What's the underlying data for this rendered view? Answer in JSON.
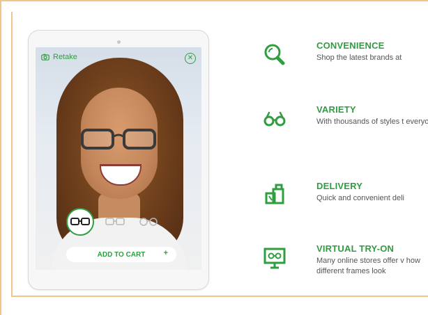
{
  "tablet": {
    "retake_label": "Retake",
    "close_glyph": "✕",
    "add_to_cart_label": "ADD TO CART",
    "plus_glyph": "+"
  },
  "features": [
    {
      "title": "CONVENIENCE",
      "desc": "Shop the latest brands at"
    },
    {
      "title": "VARIETY",
      "desc": "With thousands of styles t everyone"
    },
    {
      "title": "DELIVERY",
      "desc": "Quick and convenient deli"
    },
    {
      "title": "VIRTUAL TRY-ON",
      "desc": "Many online stores offer v how different frames look"
    }
  ],
  "colors": {
    "accent": "#2e9e3f",
    "frame_border": "#f3c48a",
    "text": "#555555"
  }
}
